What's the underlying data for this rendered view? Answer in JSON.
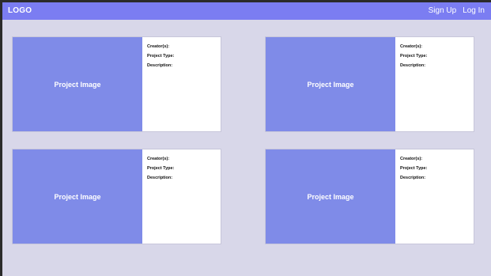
{
  "navbar": {
    "logo": "LOGO",
    "links": [
      "Sign Up",
      "Log In"
    ]
  },
  "cards": [
    {
      "image_label": "Project Image",
      "creators_label": "Creator(s):",
      "project_type_label": "Project Type:",
      "description_label": "Description:"
    },
    {
      "image_label": "Project Image",
      "creators_label": "Creator(s):",
      "project_type_label": "Project Type:",
      "description_label": "Description:"
    },
    {
      "image_label": "Project Image",
      "creators_label": "Creator(s):",
      "project_type_label": "Project Type:",
      "description_label": "Description:"
    },
    {
      "image_label": "Project Image",
      "creators_label": "Creator(s):",
      "project_type_label": "Project Type:",
      "description_label": "Description:"
    }
  ]
}
